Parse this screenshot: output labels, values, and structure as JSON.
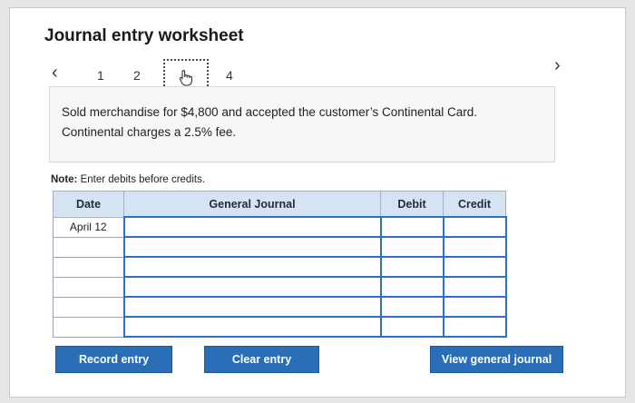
{
  "worksheet": {
    "title": "Journal entry worksheet",
    "steps": [
      "1",
      "2",
      "4"
    ],
    "current_step_icon": "hand-pointer-icon"
  },
  "question": {
    "line1": "Sold merchandise for $4,800 and accepted the customer’s Continental Card.",
    "line2": "Continental charges a 2.5% fee."
  },
  "note": {
    "label": "Note:",
    "text": "Enter debits before credits."
  },
  "journal": {
    "headers": {
      "date": "Date",
      "general_journal": "General Journal",
      "debit": "Debit",
      "credit": "Credit"
    },
    "rows": [
      {
        "date": "April 12",
        "account": "",
        "debit": "",
        "credit": ""
      },
      {
        "date": "",
        "account": "",
        "debit": "",
        "credit": ""
      },
      {
        "date": "",
        "account": "",
        "debit": "",
        "credit": ""
      },
      {
        "date": "",
        "account": "",
        "debit": "",
        "credit": ""
      },
      {
        "date": "",
        "account": "",
        "debit": "",
        "credit": ""
      },
      {
        "date": "",
        "account": "",
        "debit": "",
        "credit": ""
      }
    ]
  },
  "buttons": {
    "record": "Record entry",
    "clear": "Clear entry",
    "view": "View general journal"
  },
  "colors": {
    "header_bg": "#d6e3f2",
    "button_bg": "#2a6eb8",
    "input_border": "#2a72c6"
  }
}
